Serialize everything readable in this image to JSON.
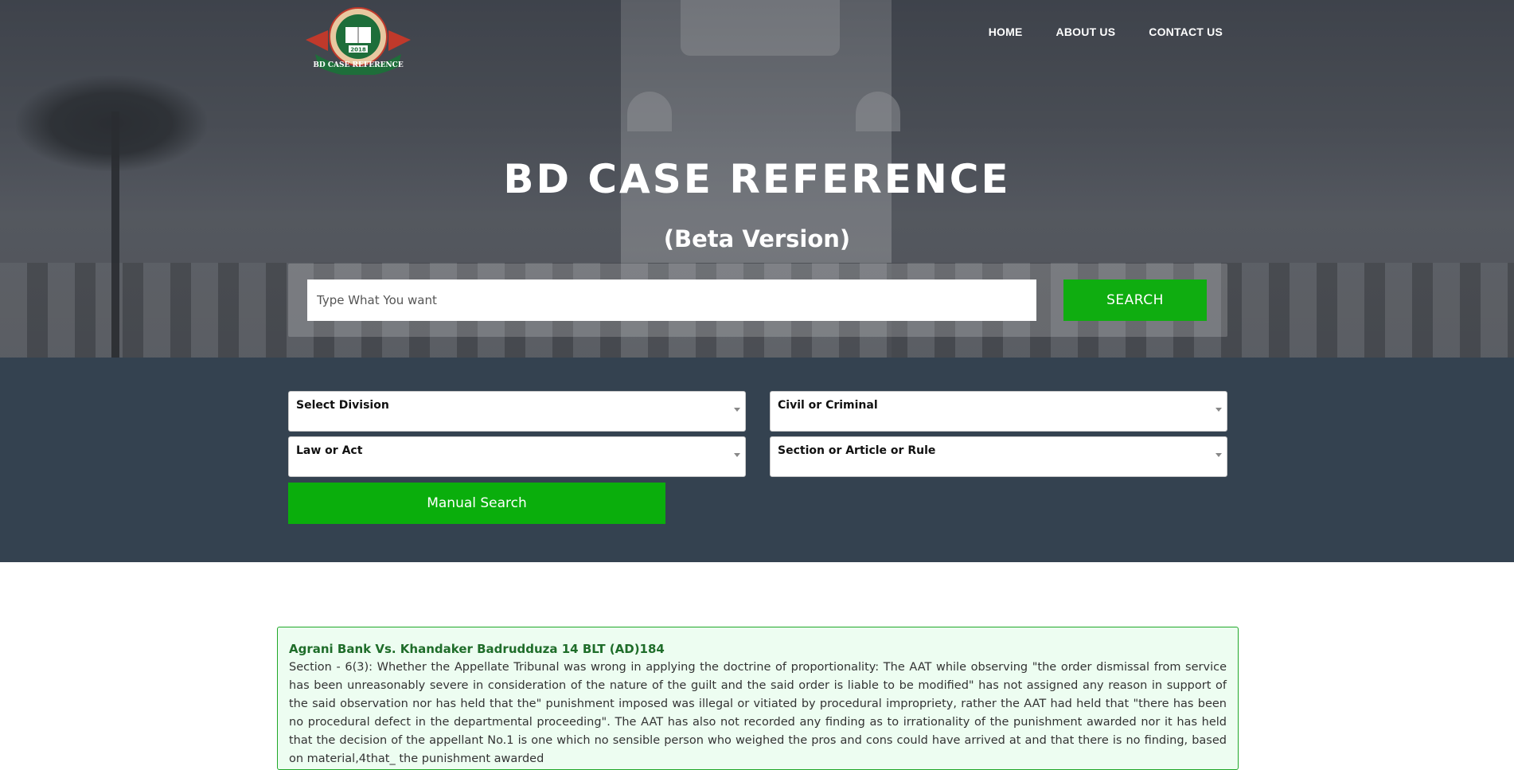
{
  "brand": {
    "logo_text": "BD CASE REFERENCE",
    "logo_year": "2018",
    "colors": {
      "green": "#0fad10",
      "dark": "#344250",
      "card_border": "#20a829",
      "card_bg": "#edfdf1"
    }
  },
  "nav": {
    "items": [
      {
        "label": "HOME"
      },
      {
        "label": "ABOUT US"
      },
      {
        "label": "CONTACT US"
      }
    ]
  },
  "hero": {
    "title": "BD CASE REFERENCE",
    "subtitle": "(Beta Version)"
  },
  "search": {
    "placeholder": "Type What You want",
    "button_label": "SEARCH"
  },
  "filters": {
    "division": {
      "label": "Select Division"
    },
    "case_type": {
      "label": "Civil or Criminal"
    },
    "law": {
      "label": "Law or Act"
    },
    "section": {
      "label": "Section or Article or Rule"
    },
    "manual_button": "Manual Search"
  },
  "results": [
    {
      "title": "Agrani Bank Vs. Khandaker Badrudduza 14 BLT (AD)184",
      "body": "Section - 6(3): Whether the Appellate Tribunal was wrong in applying the doctrine of proportionality: The AAT while observing \"the order dismissal from service has been unreasonably severe in consideration of the nature of the guilt and the said order is liable to be modified\" has not assigned any reason in support of the said observation nor has held that the\" punishment imposed was illegal or vitiated by procedural impropriety, rather the AAT had held that \"there has been no procedural defect in the departmental proceeding\". The AAT has also not recorded any finding as to irrationality of the punishment awarded nor it has held that the decision of the appellant No.1 is one which no sensible person who weighed the pros and cons could have arrived at and that there is no finding, based on material,4that_ the punishment awarded"
    }
  ]
}
